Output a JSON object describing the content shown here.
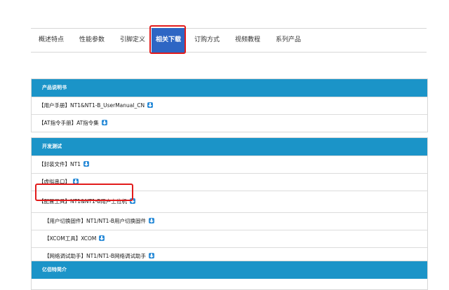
{
  "tabs": [
    {
      "label": "概述特点"
    },
    {
      "label": "性能参数"
    },
    {
      "label": "引脚定义"
    },
    {
      "label": "相关下载",
      "active": true
    },
    {
      "label": "订购方式"
    },
    {
      "label": "视频教程"
    },
    {
      "label": "系列产品"
    }
  ],
  "sections": [
    {
      "title": "产品说明书",
      "items": [
        {
          "text": "【用户手册】NT1&NT1-B_UserManual_CN",
          "icon": "download-icon"
        },
        {
          "text": "【AT指令手册】AT指令集",
          "icon": "download-icon"
        }
      ]
    },
    {
      "title": "开发测试",
      "items": [
        {
          "text": "【封装文件】NT1",
          "icon": "download-icon"
        },
        {
          "text": "【虚拟串口】",
          "icon": "download-icon"
        },
        {
          "text": "【配置工具】NT1&NT1-B用户上位机",
          "icon": "download-icon",
          "highlighted": true
        },
        {
          "text": "【用户切换固件】NT1/NT1-B用户切换固件",
          "icon": "download-icon"
        },
        {
          "text": "【XCOM工具】XCOM",
          "icon": "download-icon"
        },
        {
          "text": "【网络调试助手】NT1/NT1-B网络调试助手",
          "icon": "download-icon"
        }
      ]
    },
    {
      "title": "亿佰特简介",
      "items": []
    }
  ],
  "colors": {
    "tab_active_bg": "#2e66c4",
    "section_header_bg": "#1b94c8",
    "highlight_border": "#e21b1b",
    "download_icon": "#2b8cd8"
  }
}
